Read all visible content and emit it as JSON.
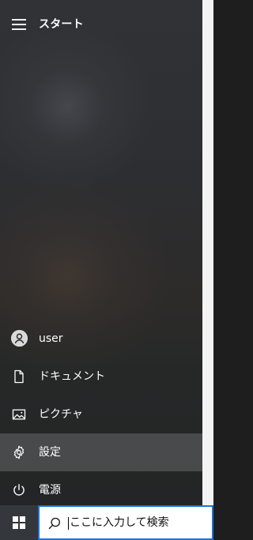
{
  "start_menu": {
    "title": "スタート",
    "items": [
      {
        "label": "user",
        "icon": "user-avatar-icon"
      },
      {
        "label": "ドキュメント",
        "icon": "document-icon"
      },
      {
        "label": "ピクチャ",
        "icon": "picture-icon"
      },
      {
        "label": "設定",
        "icon": "gear-icon",
        "selected": true
      },
      {
        "label": "電源",
        "icon": "power-icon"
      }
    ]
  },
  "taskbar": {
    "search": {
      "placeholder": "ここに入力して検索",
      "value": ""
    }
  },
  "colors": {
    "menu_background": "#2d2f33",
    "menu_text": "#ffffff",
    "selected_item": "#4b4b4b",
    "search_border": "#1a73d9",
    "taskbar_background": "#1f2527"
  }
}
